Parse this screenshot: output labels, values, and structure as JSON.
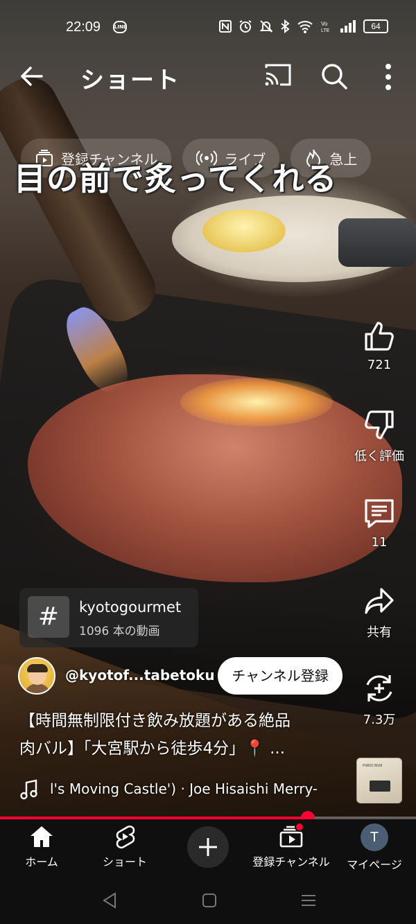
{
  "status_bar": {
    "time": "22:09",
    "line_badge": "LINE",
    "battery": "64",
    "icons": [
      "nfc-icon",
      "alarm-icon",
      "mute-icon",
      "bluetooth-icon",
      "wifi-icon",
      "volte-icon",
      "signal-icon",
      "battery-icon"
    ]
  },
  "app_bar": {
    "title": "ショート"
  },
  "chips": [
    {
      "label": "登録チャンネル",
      "icon": "subscriptions-icon"
    },
    {
      "label": "ライブ",
      "icon": "live-icon"
    },
    {
      "label": "急上",
      "icon": "trending-icon"
    }
  ],
  "video": {
    "overlay_caption": "目の前で炙ってくれる"
  },
  "actions": {
    "like": "721",
    "dislike": "低く評価",
    "comments": "11",
    "share": "共有",
    "remix": "7.3万"
  },
  "hashtag": {
    "name": "kyotogourmet",
    "count": "1096 本の動画",
    "symbol": "#"
  },
  "channel": {
    "handle": "@kyotof...tabetoku",
    "subscribe_label": "チャンネル登録"
  },
  "description": {
    "line1": "【時間無制限付き飲み放題がある絶品",
    "line2": "肉バル】「大宮駅から徒歩4分」📍 ..."
  },
  "music": {
    "text": "l's Moving Castle') · Joe Hisaishi     Merry-"
  },
  "album_art": {
    "mini_text": "PIANO BGM"
  },
  "progress": {
    "fraction": 0.74
  },
  "bottom_nav": {
    "home": "ホーム",
    "shorts": "ショート",
    "subscriptions": "登録チャンネル",
    "mypage": "マイページ",
    "avatar_letter": "T"
  },
  "colors": {
    "accent": "#ff0033",
    "nav_bg": "#0f0f0f"
  }
}
